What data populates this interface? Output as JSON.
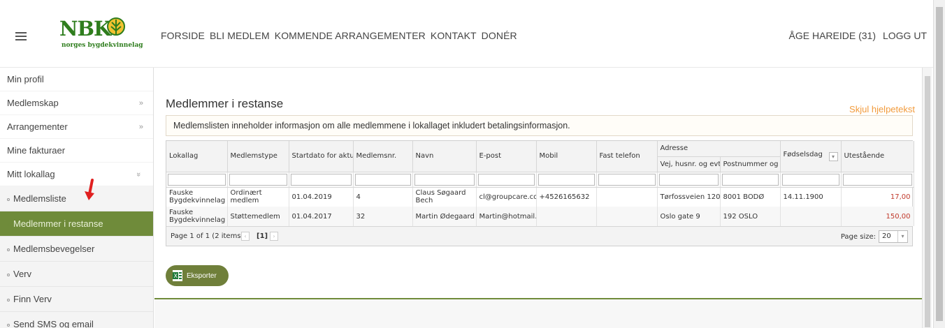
{
  "header": {
    "logo_text": "NBK",
    "logo_subtitle": "norges bygdekvinnelag",
    "nav": [
      "FORSIDE",
      "BLI MEDLEM",
      "KOMMENDE ARRANGEMENTER",
      "KONTAKT",
      "DONÉR"
    ],
    "user": "ÅGE HAREIDE (31)",
    "logout": "LOGG UT"
  },
  "sidebar": {
    "items": [
      {
        "label": "Min profil",
        "arrow": ""
      },
      {
        "label": "Medlemskap",
        "arrow": "»"
      },
      {
        "label": "Arrangementer",
        "arrow": "»"
      },
      {
        "label": "Mine fakturaer",
        "arrow": ""
      },
      {
        "label": "Mitt lokallag",
        "arrow": "»"
      }
    ],
    "subitems": [
      {
        "label": "Medlemsliste",
        "active": false
      },
      {
        "label": "Medlemmer i restanse",
        "active": true
      },
      {
        "label": "Medlemsbevegelser",
        "active": false
      },
      {
        "label": "Verv",
        "active": false
      },
      {
        "label": "Finn Verv",
        "active": false
      },
      {
        "label": "Send SMS og email",
        "active": false
      }
    ]
  },
  "main": {
    "title": "Medlemmer i restanse",
    "help_link": "Skjul hjelpetekst",
    "help_text": "Medlemslisten inneholder informasjon om alle medlemmene i lokallaget inkludert betalingsinformasjon.",
    "columns": {
      "lokallag": "Lokallag",
      "medlemstype": "Medlemstype",
      "startdato": "Startdato for aktu",
      "medlemsnr": "Medlemsnr.",
      "navn": "Navn",
      "epost": "E-post",
      "mobil": "Mobil",
      "fast_telefon": "Fast telefon",
      "adresse": "Adresse",
      "vej": "Vej, husnr. og evt.",
      "postnummer": "Postnummer og by",
      "fodselsdag": "Fødselsdag",
      "utestaende": "Utestående"
    },
    "rows": [
      {
        "lokallag": "Fauske Bygdekvinnelag",
        "medlemstype": "Ordinært medlem",
        "startdato": "01.04.2019",
        "medlemsnr": "4",
        "navn": "Claus Søgaard Bech",
        "epost": "cl@groupcare.com",
        "mobil": "+4526165632",
        "fast_telefon": "",
        "vej": "Tørfossveien 120",
        "postnummer": "8001 BODØ",
        "fodselsdag": "14.11.1900",
        "utestaende": "17,00"
      },
      {
        "lokallag": "Fauske Bygdekvinnelag",
        "medlemstype": "Støttemedlem",
        "startdato": "01.04.2017",
        "medlemsnr": "32",
        "navn": "Martin Ødegaard",
        "epost": "Martin@hotmail.cc",
        "mobil": "",
        "fast_telefon": "",
        "vej": "Oslo gate 9",
        "postnummer": "192 OSLO",
        "fodselsdag": "",
        "utestaende": "150,00"
      }
    ],
    "pager": {
      "info": "Page 1 of 1 (2 items)",
      "current": "[1]",
      "page_size_label": "Page size:",
      "page_size": "20"
    },
    "export_label": "Eksporter"
  },
  "colors": {
    "brand_green": "#6f8b3a",
    "help_orange": "#f29b3c",
    "amount_red": "#c0392b"
  }
}
